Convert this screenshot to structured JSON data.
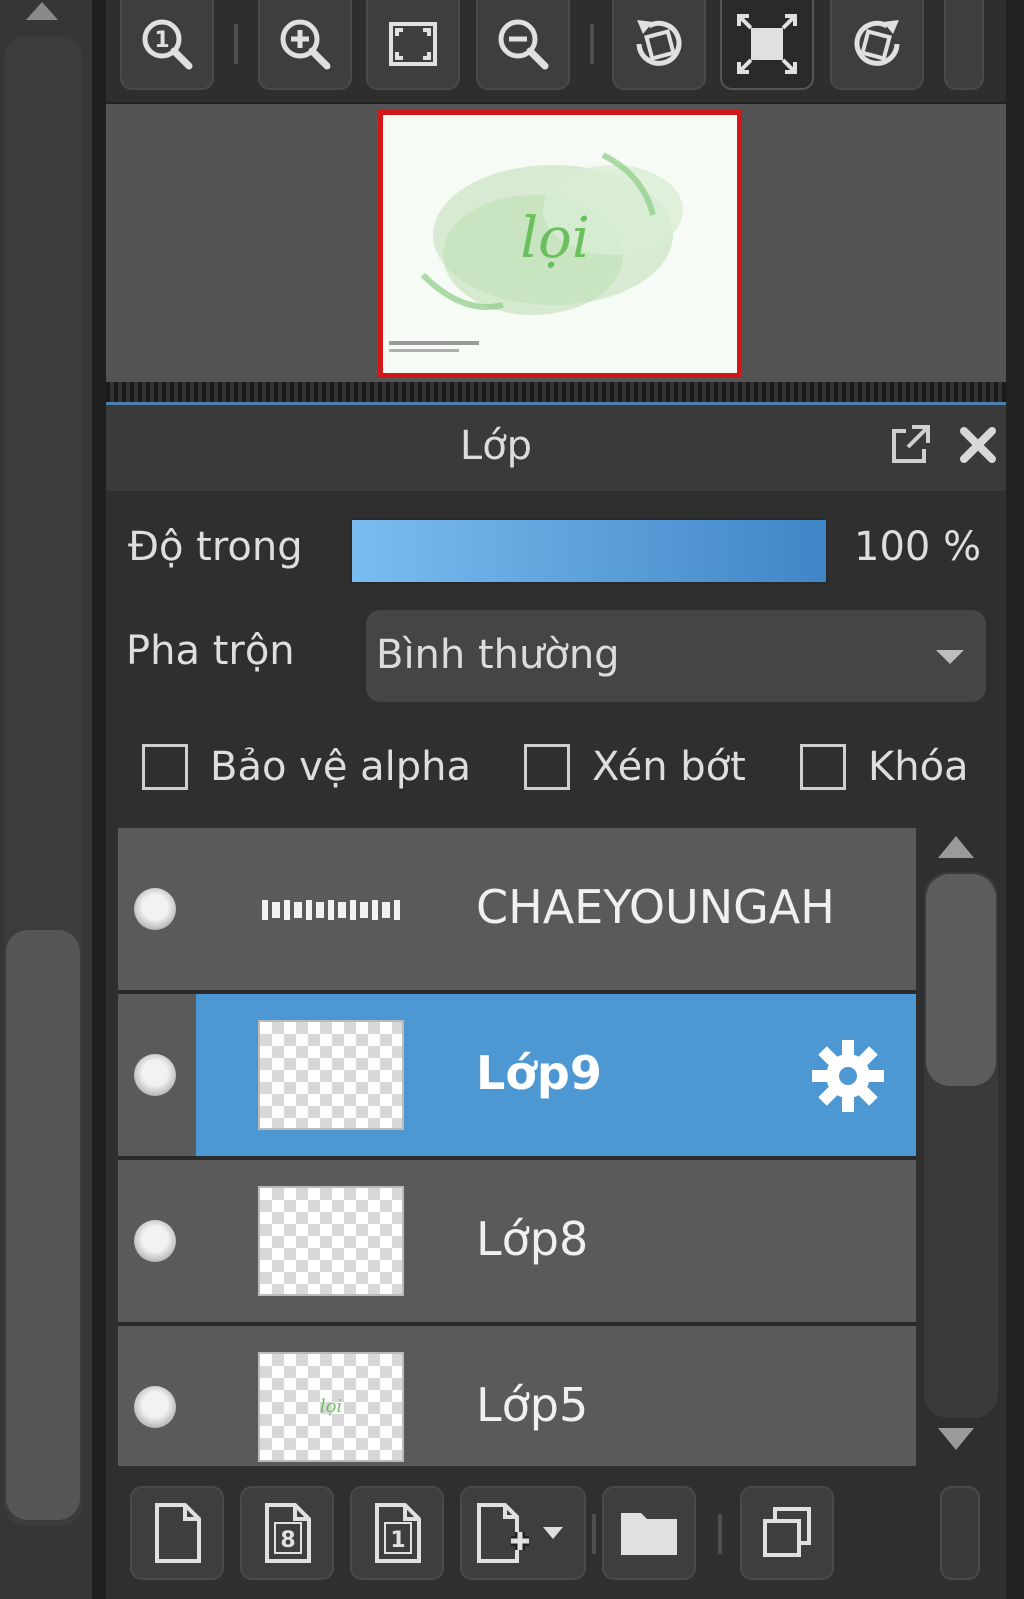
{
  "navigator": {
    "toolbar": [
      {
        "name": "zoom-100-button",
        "icon": "zoom-actual-size-icon"
      },
      {
        "name": "zoom-in-button",
        "icon": "zoom-in-icon"
      },
      {
        "name": "fit-window-button",
        "icon": "fit-window-icon"
      },
      {
        "name": "zoom-out-button",
        "icon": "zoom-out-icon"
      },
      {
        "name": "rotate-left-button",
        "icon": "rotate-left-icon"
      },
      {
        "name": "full-screen-button",
        "icon": "full-screen-icon"
      },
      {
        "name": "rotate-right-button",
        "icon": "rotate-right-icon"
      }
    ],
    "preview": {
      "thumbnail_text": "lọi"
    }
  },
  "layer_panel": {
    "title": "Lớp",
    "opacity": {
      "label": "Độ trong",
      "value_text": "100 %",
      "value": 100
    },
    "blend": {
      "label": "Pha trộn",
      "selected": "Bình thường"
    },
    "checkboxes": {
      "protect_alpha": {
        "label": "Bảo vệ alpha",
        "checked": false
      },
      "clipping": {
        "label": "Xén bớt",
        "checked": false
      },
      "lock": {
        "label": "Khóa",
        "checked": false
      }
    },
    "layers": [
      {
        "name": "CHAEYOUNGAH",
        "selected": false,
        "thumb": "text"
      },
      {
        "name": "Lớp9",
        "selected": true,
        "thumb": "transparent"
      },
      {
        "name": "Lớp8",
        "selected": false,
        "thumb": "transparent"
      },
      {
        "name": "Lớp5",
        "selected": false,
        "thumb": "transparent-with-text",
        "thumb_text": "lọi"
      }
    ],
    "bottom_toolbar": [
      {
        "name": "new-layer-button",
        "icon": "new-page-icon"
      },
      {
        "name": "new-8bit-layer-button",
        "icon": "page-8-icon",
        "text": "8"
      },
      {
        "name": "new-1bit-layer-button",
        "icon": "page-1-icon",
        "text": "1"
      },
      {
        "name": "add-layer-menu-button",
        "icon": "add-page-dropdown-icon"
      },
      {
        "name": "new-folder-button",
        "icon": "folder-icon"
      },
      {
        "name": "duplicate-layer-button",
        "icon": "duplicate-icon"
      }
    ]
  },
  "colors": {
    "accent": "#4d97d3",
    "preview_border": "#d01818",
    "opacity_bar_start": "#7bbcf0",
    "opacity_bar_end": "#3f86c6"
  }
}
